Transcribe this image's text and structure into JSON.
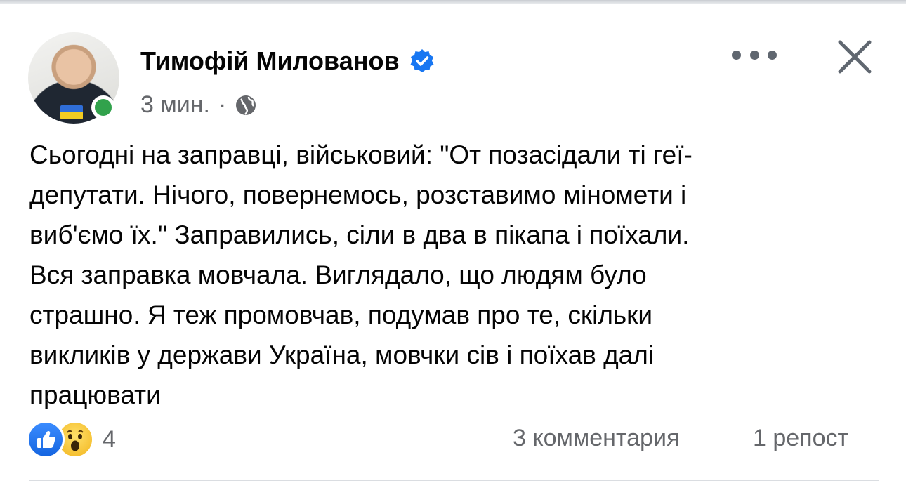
{
  "post": {
    "author": "Тимофій Милованов",
    "time": "3 мин.",
    "separator": "·",
    "text": "Сьогодні на заправці, військовий: \"От позасідали ті геї-\nдепутати. Нічого, повернемось, розставимо міномети і\nвиб'ємо їх.\" Заправились, сіли в два в пікапа і поїхали.\nВся заправка мовчала. Виглядало, що людям було\nстрашно. Я теж промовчав, подумав про те, скільки\nвикликів у держави Україна, мовчки сів і поїхав далі\nпрацювати",
    "reaction_count": "4",
    "comments": "3 комментария",
    "shares": "1 репост"
  },
  "colors": {
    "verified": "#1877f2",
    "online": "#31a24c",
    "secondary_text": "#65676b"
  },
  "icons": [
    "verified-icon",
    "globe-icon",
    "more-icon",
    "close-icon",
    "like-icon",
    "wow-icon"
  ]
}
